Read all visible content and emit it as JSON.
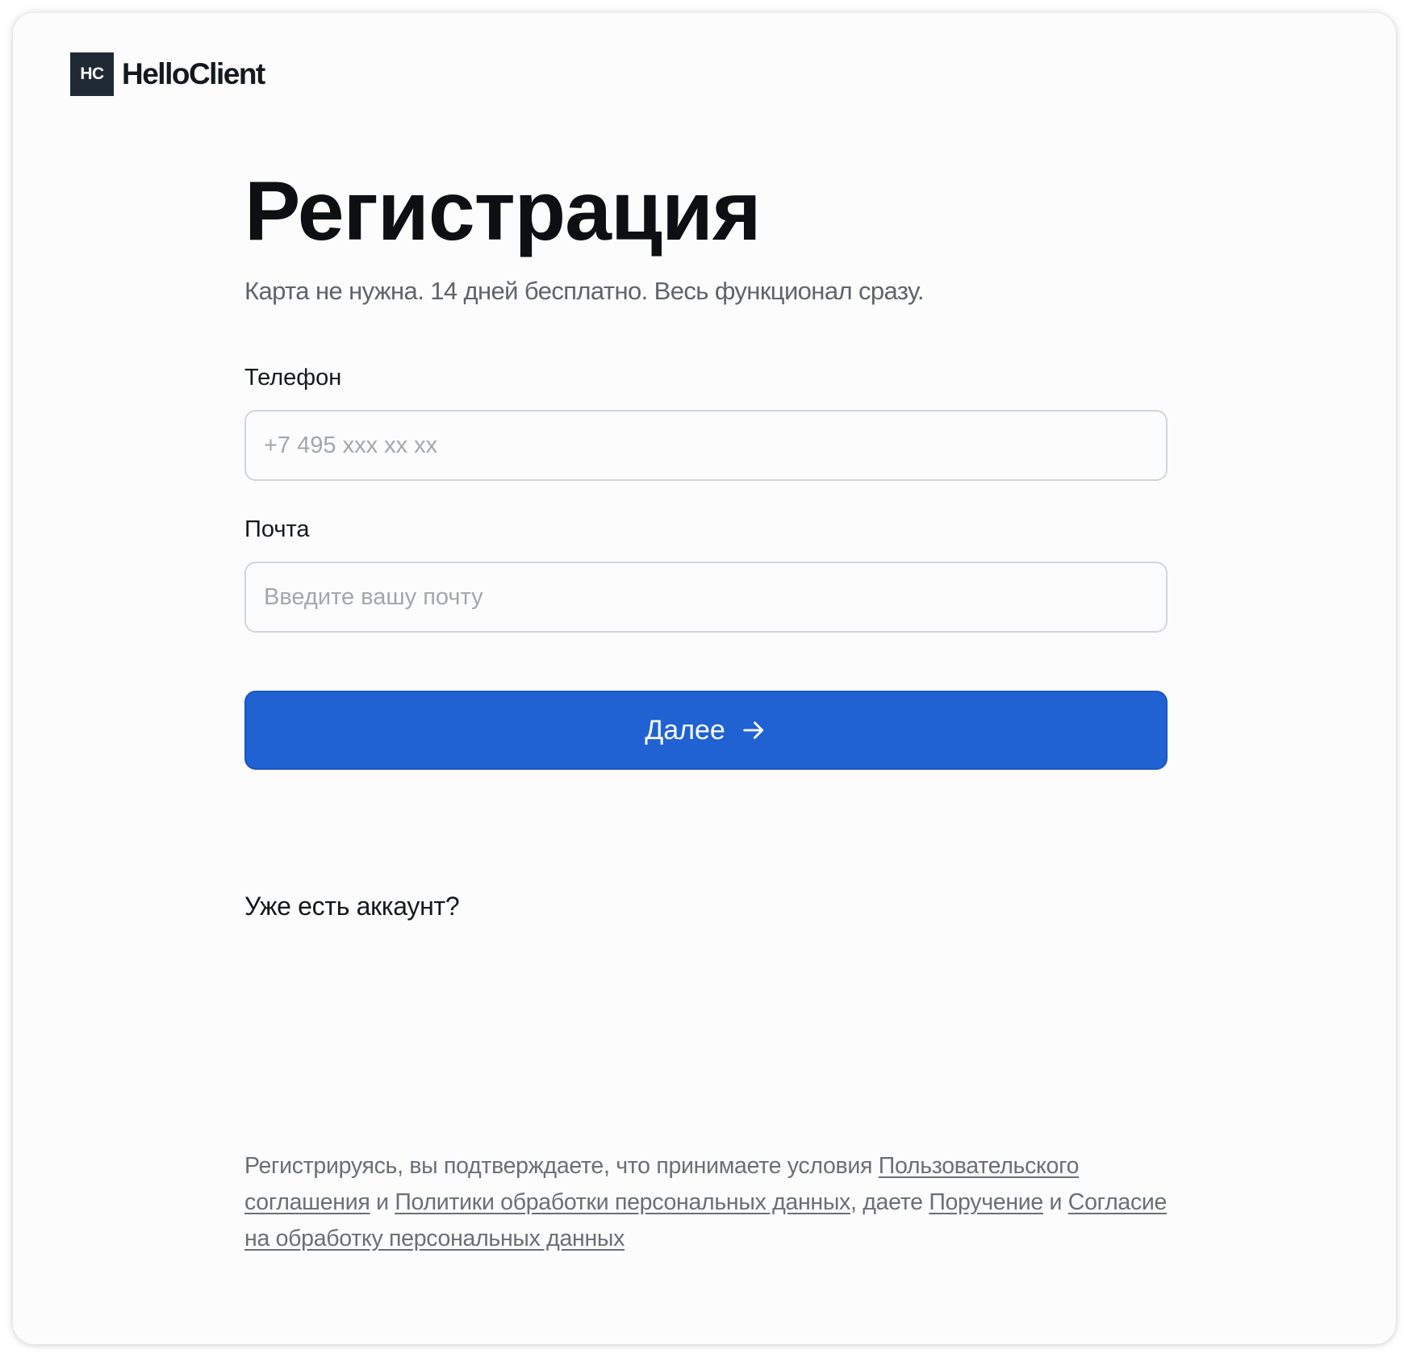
{
  "brand": {
    "mark": "HC",
    "name": "HelloClient"
  },
  "page": {
    "title": "Регистрация",
    "subtitle": "Карта не нужна. 14 дней бесплатно. Весь функционал сразу."
  },
  "form": {
    "phone": {
      "label": "Телефон",
      "placeholder": "+7 495 xxx xx xx",
      "value": ""
    },
    "email": {
      "label": "Почта",
      "placeholder": "Введите вашу почту",
      "value": ""
    },
    "submit": {
      "label": "Далее",
      "icon": "arrow-right-icon"
    }
  },
  "login": {
    "text": "Уже есть аккаунт?"
  },
  "legal": {
    "intro": "Регистрируясь, вы подтверждаете, что принимаете условия ",
    "link_user_agreement": "Пользовательского соглашения",
    "and_1": " и ",
    "link_privacy_policy": "Политики обработки персональных данных",
    "comma_give": ", даете ",
    "link_assignment": "Поручение",
    "and_2": " и ",
    "link_consent": "Согласие на обработку персональных данных"
  },
  "colors": {
    "accent": "#2162d3",
    "logo_bg": "#1f2a34",
    "card_bg": "#fcfcfc",
    "muted_text": "#6a6f74"
  }
}
